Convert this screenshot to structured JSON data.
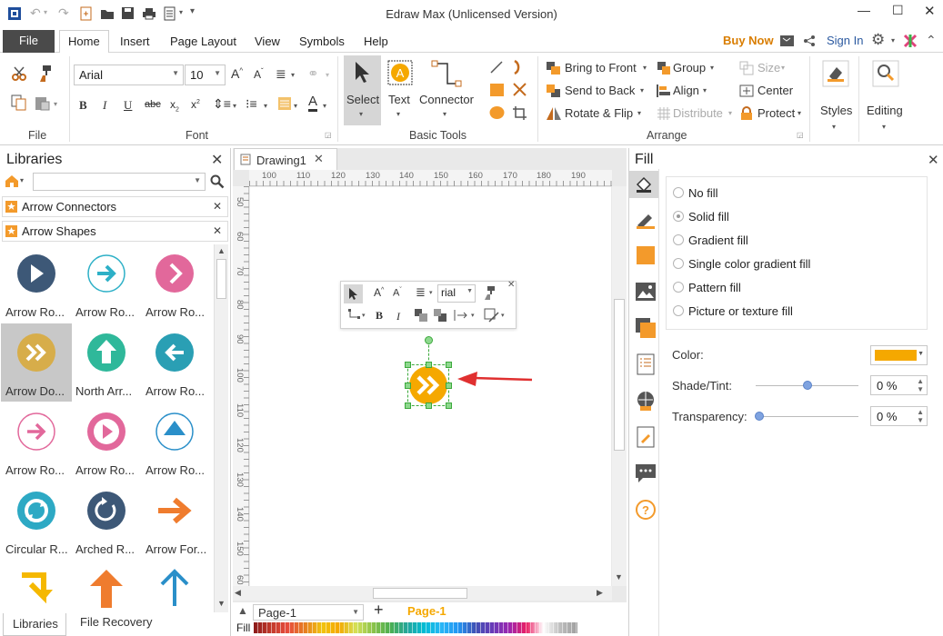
{
  "window": {
    "title": "Edraw Max (Unlicensed Version)"
  },
  "menu": {
    "file": "File",
    "tabs": [
      "Home",
      "Insert",
      "Page Layout",
      "View",
      "Symbols",
      "Help"
    ],
    "buy_now": "Buy Now",
    "sign_in": "Sign In"
  },
  "ribbon": {
    "font_name": "Arial",
    "font_size": "10",
    "groups": {
      "file": "File",
      "font": "Font",
      "basic_tools": "Basic Tools",
      "arrange": "Arrange"
    },
    "tools": {
      "select": "Select",
      "text": "Text",
      "connector": "Connector"
    },
    "arrange": {
      "bring_front": "Bring to Front",
      "send_back": "Send to Back",
      "rotate_flip": "Rotate & Flip",
      "group": "Group",
      "align": "Align",
      "distribute": "Distribute",
      "size": "Size",
      "center": "Center",
      "protect": "Protect"
    },
    "styles": "Styles",
    "editing": "Editing"
  },
  "libraries": {
    "title": "Libraries",
    "search_placeholder": "",
    "sections": [
      "Arrow Connectors",
      "Arrow Shapes"
    ],
    "shapes": [
      {
        "label": "Arrow Ro...",
        "icon": "arrow-round-play-dark"
      },
      {
        "label": "Arrow Ro...",
        "icon": "arrow-round-right-teal"
      },
      {
        "label": "Arrow Ro...",
        "icon": "arrow-round-chevron-pink"
      },
      {
        "label": "Arrow Do...",
        "icon": "arrow-double-chevron-gold"
      },
      {
        "label": "North Arr...",
        "icon": "arrow-north-green"
      },
      {
        "label": "Arrow Ro...",
        "icon": "arrow-round-left-teal"
      },
      {
        "label": "Arrow Ro...",
        "icon": "arrow-round-right-pink"
      },
      {
        "label": "Arrow Ro...",
        "icon": "arrow-round-play-pink"
      },
      {
        "label": "Arrow Ro...",
        "icon": "arrow-round-up-blue"
      },
      {
        "label": "Circular R...",
        "icon": "circular-refresh-teal"
      },
      {
        "label": "Arched R...",
        "icon": "arched-refresh-dark"
      },
      {
        "label": "Arrow For...",
        "icon": "arrow-forward-orange"
      },
      {
        "label": "",
        "icon": "arrow-down-yellow"
      },
      {
        "label": "",
        "icon": "arrow-up-orange"
      },
      {
        "label": "",
        "icon": "arrow-up-blue"
      }
    ],
    "bottom_tabs": [
      "Libraries",
      "File Recovery"
    ]
  },
  "canvas": {
    "doc_tab": "Drawing1",
    "ruler_h": [
      "100",
      "110",
      "120",
      "130",
      "140",
      "150",
      "160",
      "170",
      "180",
      "190"
    ],
    "ruler_v": [
      "50",
      "60",
      "70",
      "80",
      "90",
      "100",
      "110",
      "120",
      "130",
      "140",
      "150",
      "60"
    ],
    "floating_font": "rial",
    "page_selector": "Page-1",
    "page_tab": "Page-1",
    "fill_label": "Fill"
  },
  "fill_panel": {
    "title": "Fill",
    "options": [
      "No fill",
      "Solid fill",
      "Gradient fill",
      "Single color gradient fill",
      "Pattern fill",
      "Picture or texture fill"
    ],
    "selected": "Solid fill",
    "color_label": "Color:",
    "color_value": "#f5a800",
    "shade_label": "Shade/Tint:",
    "shade_value": "0 %",
    "transparency_label": "Transparency:",
    "transparency_value": "0 %"
  },
  "colors": {
    "accent": "#f5a800",
    "buy_now": "#d97d00",
    "sign_in": "#2c5aa0"
  }
}
